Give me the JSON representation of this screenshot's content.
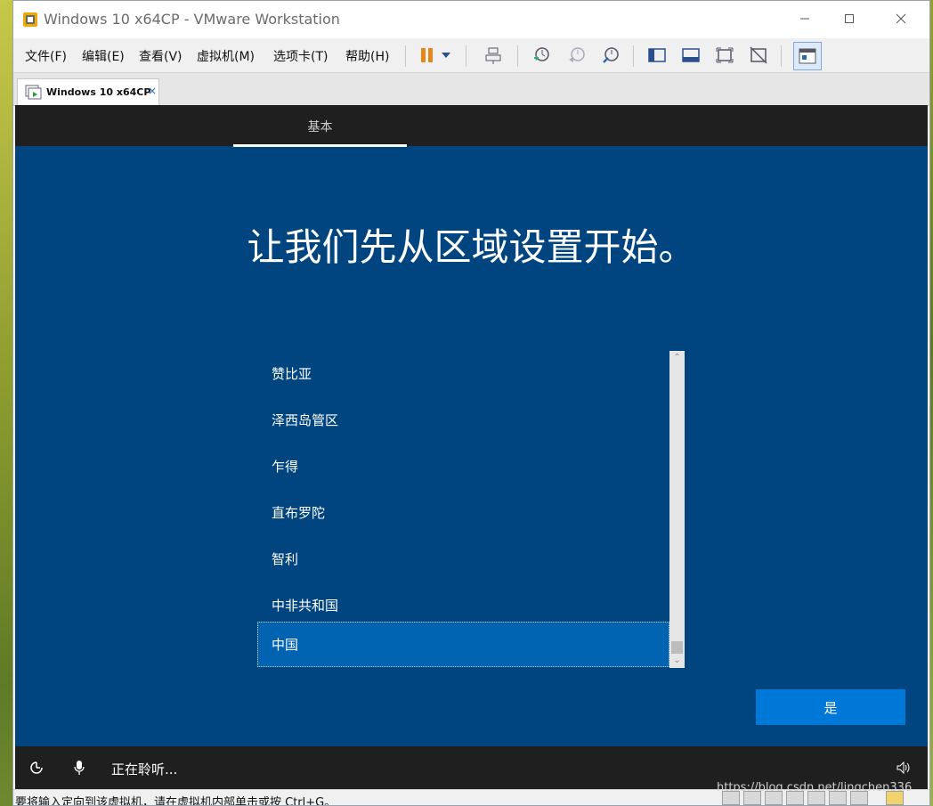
{
  "window": {
    "title": "Windows 10 x64CP - VMware Workstation",
    "controls": {
      "minimize": "—",
      "maximize": "☐",
      "close": "✕"
    }
  },
  "menubar": {
    "items": [
      {
        "label": "文件(F)"
      },
      {
        "label": "编辑(E)"
      },
      {
        "label": "查看(V)"
      },
      {
        "label": "虚拟机(M)"
      },
      {
        "label": "选项卡(T)"
      },
      {
        "label": "帮助(H)"
      }
    ]
  },
  "tab": {
    "label": "Windows 10 x64CP",
    "close": "×"
  },
  "guest": {
    "top_tab": "基本",
    "heading": "让我们先从区域设置开始。",
    "list": {
      "items": [
        "赞比亚",
        "泽西岛管区",
        "乍得",
        "直布罗陀",
        "智利",
        "中非共和国",
        "中国"
      ],
      "selected": "中国"
    },
    "yes_button": "是",
    "listening": "正在聆听...",
    "scroll_up": "⌃",
    "scroll_down": "⌄"
  },
  "statusbar": {
    "message": "要将输入定向到该虚拟机，请在虚拟机内部单击或按 Ctrl+G。",
    "watermark": "https://blog.csdn.net/lingchen336"
  },
  "colors": {
    "guest_bg": "#00457f",
    "selected_item": "#0063b1",
    "accent_button": "#0078d7"
  }
}
